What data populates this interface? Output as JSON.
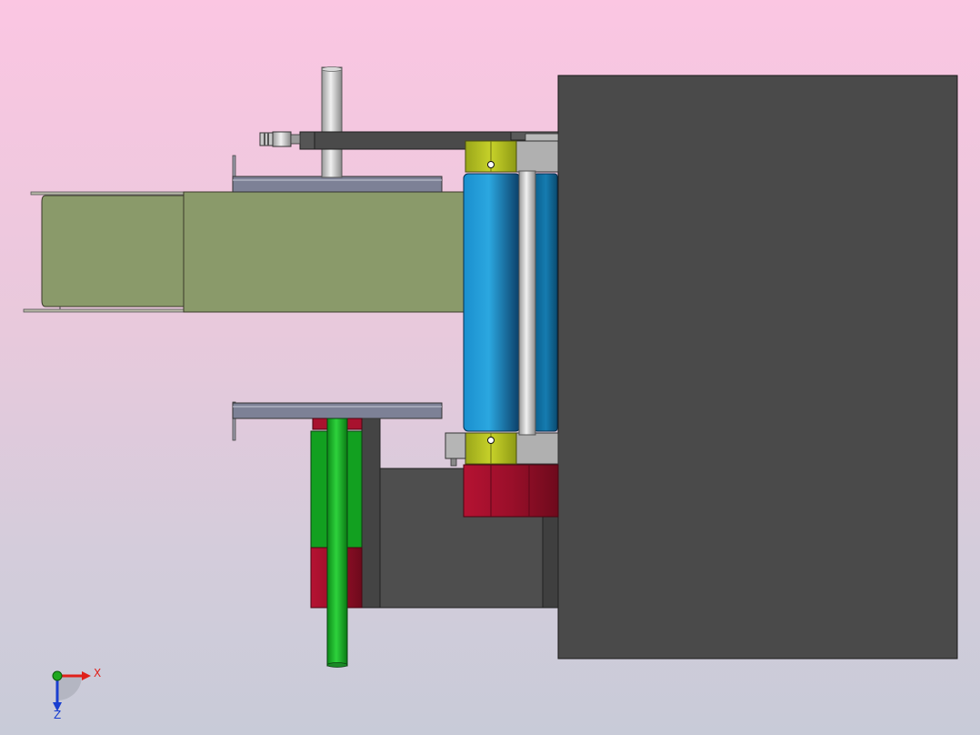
{
  "viewport": {
    "background_top": "#fbc6e2",
    "background_bottom": "#c8cbd8"
  },
  "colors": {
    "housing": "#4a4a4a",
    "roller_blue": "#1f8fc7",
    "collar_yellow": "#b6c21e",
    "block_red": "#a8122e",
    "cylinder_green": "#12a020",
    "tray_olive": "#8a9a6a",
    "frame_gray": "#8a8a8a",
    "plate_steel": "#7d8196"
  },
  "triad": {
    "x_label": "X",
    "z_label": "Z",
    "x_color": "#e0201a",
    "y_color": "#1ea81e",
    "z_color": "#1a3fd0"
  }
}
